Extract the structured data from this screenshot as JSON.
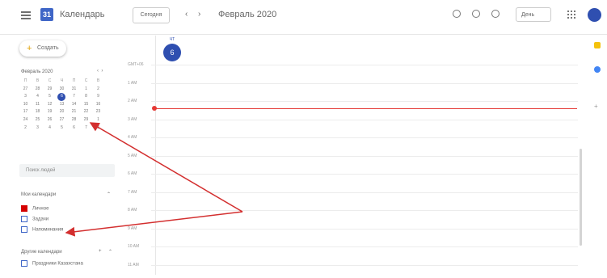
{
  "header": {
    "app_title": "Календарь",
    "today_label": "Сегодня",
    "prev_label": "‹",
    "next_label": "›",
    "date_title": "Февраль 2020",
    "view_label": "День",
    "icons": [
      "search-icon",
      "help-icon",
      "settings-icon",
      "apps-icon",
      "account-avatar"
    ]
  },
  "sidebar": {
    "create_label": "Создать",
    "create_icon": "+",
    "mini_calendar": {
      "title": "Февраль 2020",
      "prev": "‹",
      "next": "›",
      "weekdays": [
        "П",
        "В",
        "С",
        "Ч",
        "П",
        "С",
        "В"
      ],
      "rows": [
        [
          "27",
          "28",
          "29",
          "30",
          "31",
          "1",
          "2"
        ],
        [
          "3",
          "4",
          "5",
          "6",
          "7",
          "8",
          "9"
        ],
        [
          "10",
          "11",
          "12",
          "13",
          "14",
          "15",
          "16"
        ],
        [
          "17",
          "18",
          "19",
          "20",
          "21",
          "22",
          "23"
        ],
        [
          "24",
          "25",
          "26",
          "27",
          "28",
          "29",
          "1"
        ],
        [
          "2",
          "3",
          "4",
          "5",
          "6",
          "7",
          "8"
        ]
      ],
      "today": "6"
    },
    "search_people_placeholder": "Поиск людей",
    "my_calendars_title": "Мои календари",
    "my_calendars": [
      "Личное",
      "Задачи",
      "Напоминания"
    ],
    "other_calendars_title": "Другие календари",
    "other_calendars": [
      "Праздники Казахстана"
    ]
  },
  "main": {
    "day_label": "ЧТ",
    "day_number": "6",
    "time_labels": [
      "GMT+06",
      "1 AM",
      "2 AM",
      "3 AM",
      "4 AM",
      "5 AM",
      "6 AM",
      "7 AM",
      "8 AM",
      "9 AM",
      "10 AM",
      "11 AM"
    ]
  },
  "colors": {
    "accent": "#2f4fb0",
    "now_line": "#e53935",
    "annotation_arrow": "#d32f2f",
    "personal_calendar": "#d50000"
  }
}
